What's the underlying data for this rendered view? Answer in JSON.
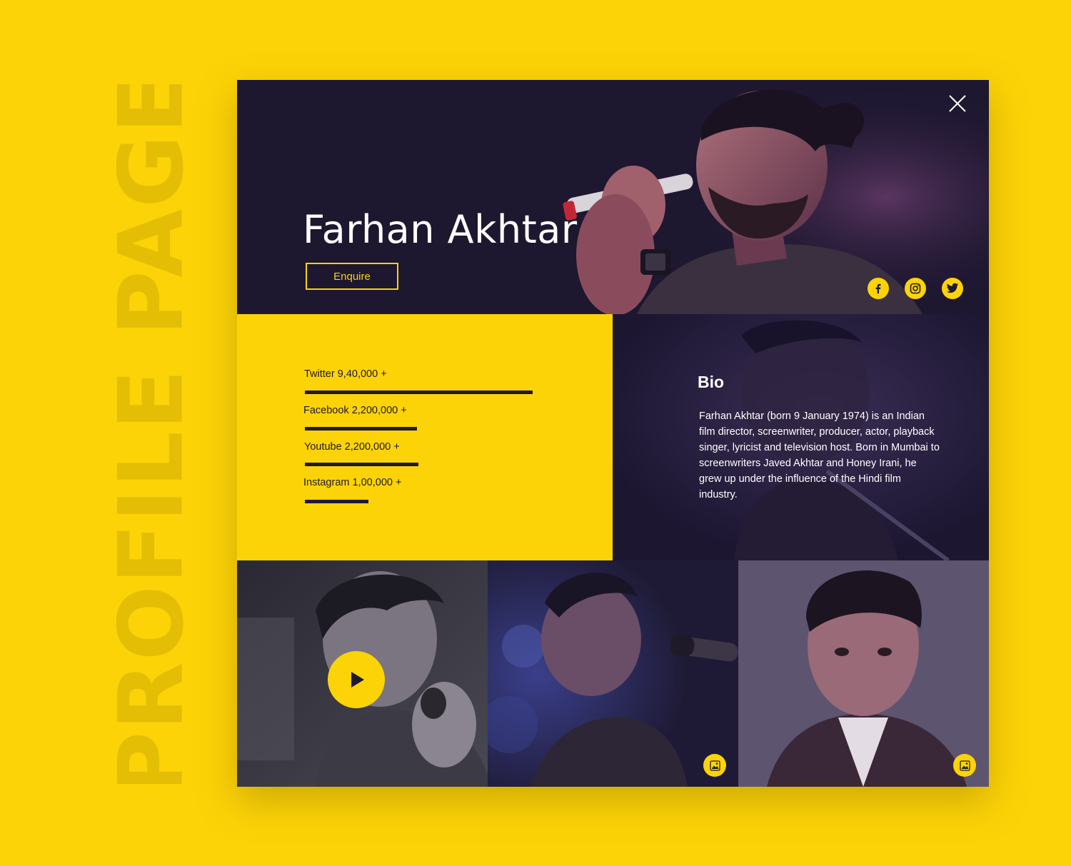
{
  "side_title": "PROFILE PAGE",
  "profile": {
    "name": "Farhan Akhtar",
    "enquire_label": "Enquire"
  },
  "social_icons": [
    "facebook-icon",
    "instagram-icon",
    "twitter-icon"
  ],
  "stats": [
    {
      "label": "Twitter 9,40,000 +",
      "share": 1.0
    },
    {
      "label": "Facebook 2,200,000 +",
      "share": 0.49
    },
    {
      "label": "Youtube 2,200,000 +",
      "share": 0.5
    },
    {
      "label": "Instagram 1,00,000 +",
      "share": 0.28
    }
  ],
  "bio": {
    "title": "Bio",
    "text": "Farhan Akhtar (born 9 January 1974) is an Indian film director, screenwriter, producer, actor, playback singer, lyricist and television host. Born in Mumbai to screenwriters Javed Akhtar and Honey Irani, he grew up under the influence of the Hindi film industry."
  },
  "gallery": [
    {
      "type": "video",
      "icon": "play-icon"
    },
    {
      "type": "image",
      "icon": "image-icon"
    },
    {
      "type": "image",
      "icon": "image-icon"
    }
  ],
  "colors": {
    "accent": "#FCD307",
    "dark": "#1E1930",
    "text_light": "#FFFFFF"
  }
}
